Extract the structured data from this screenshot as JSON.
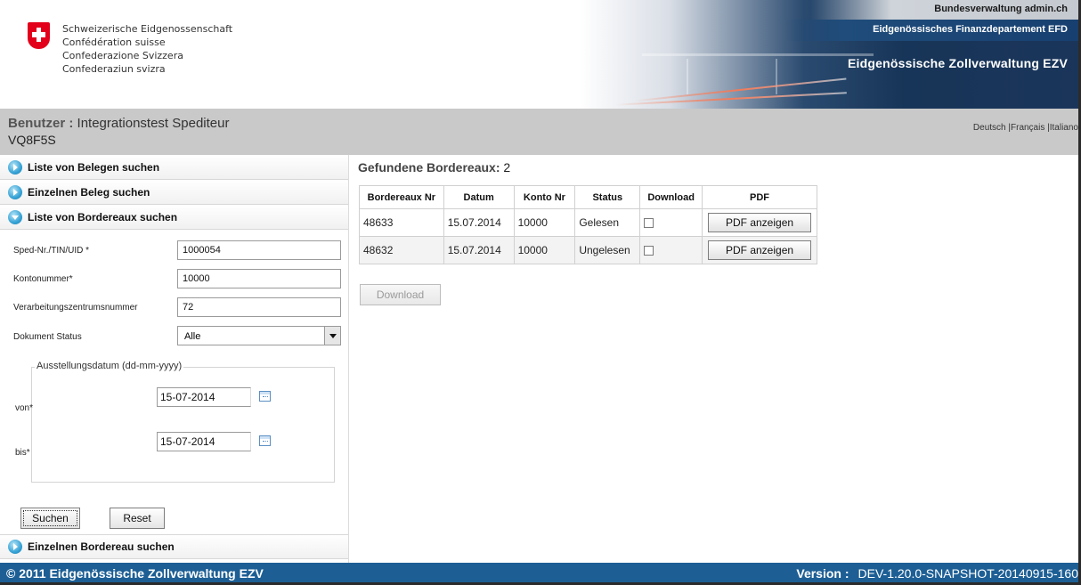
{
  "header": {
    "confederation_names": [
      "Schweizerische Eidgenossenschaft",
      "Confédération suisse",
      "Confederazione Svizzera",
      "Confederaziun svizra"
    ],
    "admin_link": "Bundesverwaltung admin.ch",
    "department": "Eidgenössisches Finanzdepartement EFD",
    "office": "Eidgenössische Zollverwaltung EZV"
  },
  "user": {
    "label": "Benutzer",
    "separator": " : ",
    "name": "Integrationstest Spediteur",
    "id": "VQ8F5S"
  },
  "languages": [
    "Deutsch",
    "Français",
    "Italiano"
  ],
  "sidebar": {
    "sections": [
      {
        "label": "Liste von Belegen suchen"
      },
      {
        "label": "Einzelnen Beleg suchen"
      },
      {
        "label": "Liste von Bordereaux suchen"
      },
      {
        "label": "Einzelnen Bordereau suchen"
      }
    ],
    "form": {
      "sped_label": "Sped-Nr./TIN/UID *",
      "sped_value": "1000054",
      "konto_label": "Kontonummer*",
      "konto_value": "10000",
      "zentrum_label": "Verarbeitungszentrumsnummer",
      "zentrum_value": "72",
      "status_label": "Dokument Status",
      "status_value": "Alle",
      "date_legend": "Ausstellungsdatum (dd-mm-yyyy)",
      "von_label": "von*",
      "von_value": "15-07-2014",
      "bis_label": "bis*",
      "bis_value": "15-07-2014",
      "search_button": "Suchen",
      "reset_button": "Reset"
    }
  },
  "results": {
    "title": "Gefundene Bordereaux:",
    "count": "2",
    "columns": [
      "Bordereaux Nr",
      "Datum",
      "Konto Nr",
      "Status",
      "Download",
      "PDF"
    ],
    "rows": [
      {
        "nr": "48633",
        "datum": "15.07.2014",
        "konto": "10000",
        "status": "Gelesen",
        "download": false,
        "pdf": "PDF anzeigen"
      },
      {
        "nr": "48632",
        "datum": "15.07.2014",
        "konto": "10000",
        "status": "Ungelesen",
        "download": false,
        "pdf": "PDF anzeigen"
      }
    ],
    "download_button": "Download"
  },
  "footer": {
    "copyright": "© 2011 Eidgenössische Zollverwaltung EZV",
    "version_label": "Version :",
    "version_value": "DEV-1.20.0-SNAPSHOT-20140915-160"
  },
  "colors": {
    "footer_bg": "#1d5f95",
    "user_bar_bg": "#c9c9c9",
    "flag_red": "#e2001a"
  }
}
